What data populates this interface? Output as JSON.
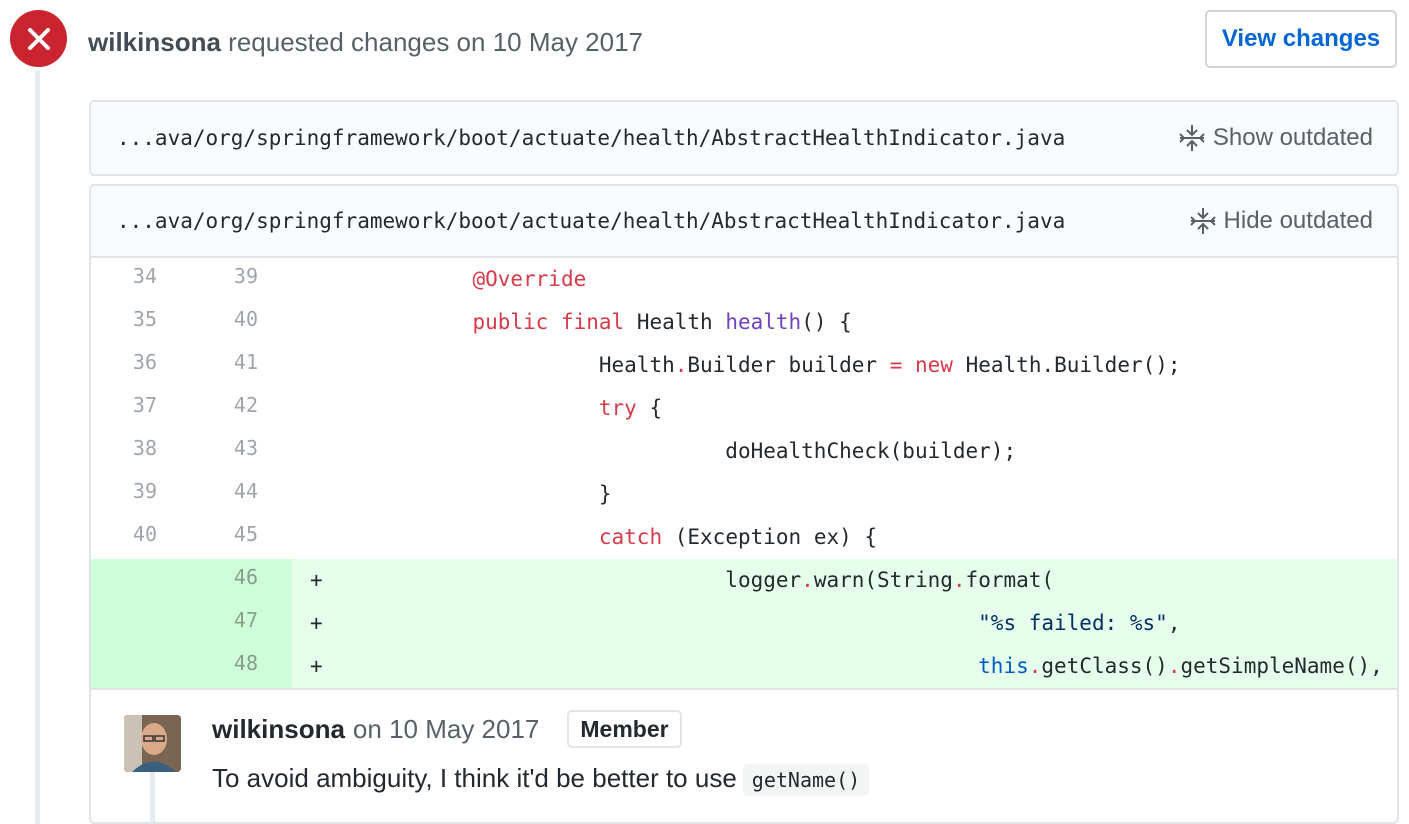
{
  "review": {
    "author": "wilkinsona",
    "action_text": "requested changes on 10 May 2017",
    "view_changes_label": "View changes"
  },
  "files": [
    {
      "path": "...ava/org/springframework/boot/actuate/health/AbstractHealthIndicator.java",
      "toggle_label": "Show outdated"
    },
    {
      "path": "...ava/org/springframework/boot/actuate/health/AbstractHealthIndicator.java",
      "toggle_label": "Hide outdated"
    }
  ],
  "diff_lines": [
    {
      "old": "34",
      "new": "39",
      "sign": "",
      "type": "context"
    },
    {
      "old": "35",
      "new": "40",
      "sign": "",
      "type": "context"
    },
    {
      "old": "36",
      "new": "41",
      "sign": "",
      "type": "context"
    },
    {
      "old": "37",
      "new": "42",
      "sign": "",
      "type": "context"
    },
    {
      "old": "38",
      "new": "43",
      "sign": "",
      "type": "context"
    },
    {
      "old": "39",
      "new": "44",
      "sign": "",
      "type": "context"
    },
    {
      "old": "40",
      "new": "45",
      "sign": "",
      "type": "context"
    },
    {
      "old": "",
      "new": "46",
      "sign": "+",
      "type": "add"
    },
    {
      "old": "",
      "new": "47",
      "sign": "+",
      "type": "add"
    },
    {
      "old": "",
      "new": "48",
      "sign": "+",
      "type": "add"
    }
  ],
  "code_tokens": {
    "l0_a": "@Override",
    "l1_a": "public",
    "l1_b": "final",
    "l1_c": "Health",
    "l1_d": "health",
    "l1_e": "() {",
    "l2_a": "Health",
    "l2_b": ".",
    "l2_c": "Builder builder",
    "l2_d": "=",
    "l2_e": "new",
    "l2_f": "Health.Builder();",
    "l3_a": "try",
    "l3_b": "{",
    "l4_a": "doHealthCheck(builder);",
    "l5_a": "}",
    "l6_a": "catch",
    "l6_b": "(Exception ex) {",
    "l7_a": "logger",
    "l7_b": ".",
    "l7_c": "warn(String",
    "l7_d": ".",
    "l7_e": "format(",
    "l8_a": "\"%s failed: %s\"",
    "l8_b": ",",
    "l9_a": "this",
    "l9_b": ".",
    "l9_c": "getClass()",
    "l9_d": ".",
    "l9_e": "getSimpleName(),"
  },
  "comment": {
    "author": "wilkinsona",
    "date_text": "on 10 May 2017",
    "badge": "Member",
    "body_text": "To avoid ambiguity, I think it'd be better to use",
    "inline_code": "getName()"
  }
}
